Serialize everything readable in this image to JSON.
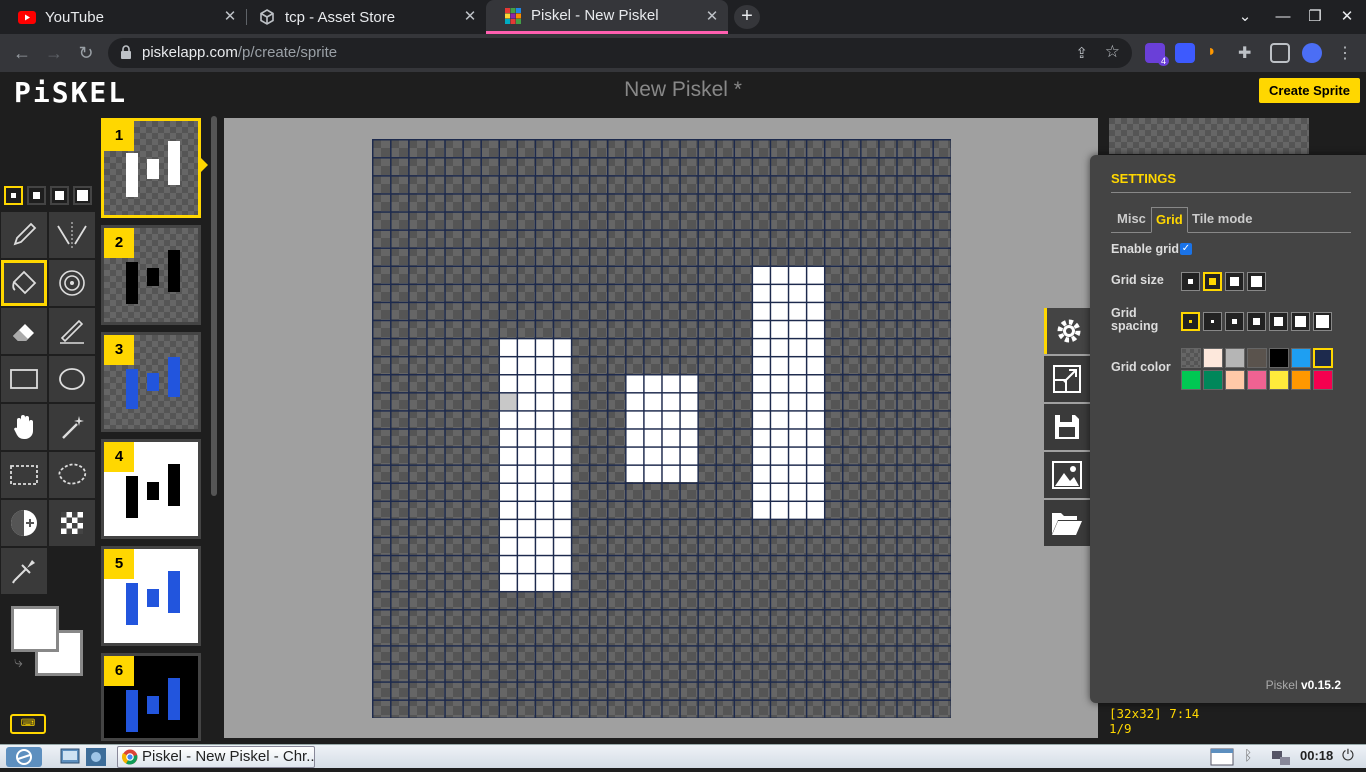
{
  "browser": {
    "tabs": [
      {
        "title": "YouTube",
        "favicon": "youtube-icon"
      },
      {
        "title": "tcp - Asset Store",
        "favicon": "unity-icon"
      },
      {
        "title": "Piskel - New Piskel",
        "favicon": "piskel-icon",
        "active": true
      }
    ],
    "url_host": "piskelapp.com",
    "url_path": "/p/create/sprite",
    "extension_badge": "4"
  },
  "app": {
    "logo": "PiSKEL",
    "title": "New Piskel *",
    "create_button": "Create Sprite"
  },
  "frames": [
    {
      "number": "1",
      "bg": "transparent",
      "bar_color": "#ffffff"
    },
    {
      "number": "2",
      "bg": "transparent",
      "bar_color": "#000000"
    },
    {
      "number": "3",
      "bg": "transparent",
      "bar_color": "#2255dd"
    },
    {
      "number": "4",
      "bg": "#ffffff",
      "bar_color": "#000000"
    },
    {
      "number": "5",
      "bg": "#ffffff",
      "bar_color": "#2255dd"
    },
    {
      "number": "6",
      "bg": "#000000",
      "bar_color": "#2255dd"
    }
  ],
  "settings": {
    "heading": "SETTINGS",
    "tabs": [
      "Misc",
      "Grid",
      "Tile mode"
    ],
    "active_tab": "Grid",
    "enable_grid_label": "Enable grid",
    "enable_grid": true,
    "grid_size_label": "Grid size",
    "grid_spacing_label": "Grid spacing",
    "grid_color_label": "Grid color",
    "grid_colors": [
      "transparent",
      "#fde8dc",
      "#b5b5b5",
      "#5a534d",
      "#000000",
      "#1e9ff2",
      "#1d2a4d",
      "#00c853",
      "#00875a",
      "#ffc9a8",
      "#f06292",
      "#ffeb3b",
      "#ff9800",
      "#f5004f"
    ],
    "selected_grid_color": "#1d2a4d",
    "version_name": "Piskel",
    "version_number": "v0.15.2"
  },
  "status": {
    "size_cursor": "[32x32] 7:14",
    "frame_counter": "1/9"
  },
  "taskbar": {
    "task_title": "Piskel - New Piskel - Chr...",
    "clock": "00:18"
  },
  "colors": {
    "accent": "#ffd700",
    "grid": "#1d2a4d",
    "primary_color": "#ffffff",
    "secondary_color": "#ffffff"
  }
}
